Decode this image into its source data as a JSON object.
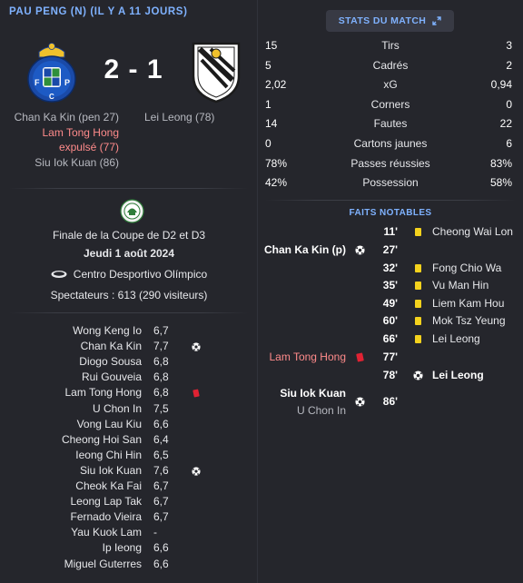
{
  "header": {
    "title": "PAU PENG (N) (IL Y A 11 JOURS)"
  },
  "score": "2 - 1",
  "home_scorers": [
    {
      "text": "Chan Ka Kin (pen 27)",
      "style": "normal"
    },
    {
      "text": "Lam Tong Hong",
      "style": "red"
    },
    {
      "text": "expulsé (77)",
      "style": "red"
    },
    {
      "text": "Siu Iok Kuan (86)",
      "style": "normal"
    }
  ],
  "away_scorers": [
    {
      "text": "Lei Leong (78)"
    }
  ],
  "match_info": {
    "competition": "Finale de la Coupe de D2 et D3",
    "date": "Jeudi 1 août 2024",
    "stadium": "Centro Desportivo Olímpico",
    "spectators": "Spectateurs : 613 (290 visiteurs)"
  },
  "lineup": [
    {
      "name": "Wong Keng Io",
      "rating": "6,7",
      "icon": ""
    },
    {
      "name": "Chan Ka Kin",
      "rating": "7,7",
      "icon": "ball"
    },
    {
      "name": "Diogo Sousa",
      "rating": "6,8",
      "icon": ""
    },
    {
      "name": "Rui Gouveia",
      "rating": "6,8",
      "icon": ""
    },
    {
      "name": "Lam Tong Hong",
      "rating": "6,8",
      "icon": "red"
    },
    {
      "name": "U Chon In",
      "rating": "7,5",
      "icon": ""
    },
    {
      "name": "Vong Lau Kiu",
      "rating": "6,6",
      "icon": ""
    },
    {
      "name": "Cheong Hoi San",
      "rating": "6,4",
      "icon": ""
    },
    {
      "name": "Ieong Chi Hin",
      "rating": "6,5",
      "icon": ""
    },
    {
      "name": "Siu Iok Kuan",
      "rating": "7,6",
      "icon": "ball"
    },
    {
      "name": "Cheok Ka Fai",
      "rating": "6,7",
      "icon": ""
    },
    {
      "name": "Leong Lap Tak",
      "rating": "6,7",
      "icon": ""
    },
    {
      "name": "Fernado Vieira",
      "rating": "6,7",
      "icon": ""
    },
    {
      "name": "Yau Kuok Lam",
      "rating": "-",
      "icon": ""
    },
    {
      "name": "Ip Ieong",
      "rating": "6,6",
      "icon": ""
    },
    {
      "name": "Miguel Guterres",
      "rating": "6,6",
      "icon": ""
    }
  ],
  "stats_button": {
    "label": "STATS DU MATCH"
  },
  "stats": [
    {
      "label": "Tirs",
      "home": "15",
      "away": "3"
    },
    {
      "label": "Cadrés",
      "home": "5",
      "away": "2"
    },
    {
      "label": "xG",
      "home": "2,02",
      "away": "0,94"
    },
    {
      "label": "Corners",
      "home": "1",
      "away": "0"
    },
    {
      "label": "Fautes",
      "home": "14",
      "away": "22"
    },
    {
      "label": "Cartons jaunes",
      "home": "0",
      "away": "6"
    },
    {
      "label": "Passes réussies",
      "home": "78%",
      "away": "83%"
    },
    {
      "label": "Possession",
      "home": "42%",
      "away": "58%"
    }
  ],
  "events_title": "FAITS NOTABLES",
  "events": [
    {
      "minute": "11'",
      "side": "away",
      "type": "yellow",
      "player": "Cheong Wai Lon"
    },
    {
      "minute": "27'",
      "side": "home",
      "type": "goal",
      "player": "Chan Ka Kin (p)"
    },
    {
      "minute": "32'",
      "side": "away",
      "type": "yellow",
      "player": "Fong Chio Wa"
    },
    {
      "minute": "35'",
      "side": "away",
      "type": "yellow",
      "player": "Vu Man Hin"
    },
    {
      "minute": "49'",
      "side": "away",
      "type": "yellow",
      "player": "Liem Kam Hou"
    },
    {
      "minute": "60'",
      "side": "away",
      "type": "yellow",
      "player": "Mok Tsz Yeung"
    },
    {
      "minute": "66'",
      "side": "away",
      "type": "yellow",
      "player": "Lei Leong"
    },
    {
      "minute": "77'",
      "side": "home",
      "type": "red",
      "player": "Lam Tong Hong"
    },
    {
      "minute": "78'",
      "side": "away",
      "type": "goal",
      "player": "Lei Leong"
    },
    {
      "minute": "86'",
      "side": "home",
      "type": "goal",
      "player": "Siu Iok Kuan",
      "assist": "U Chon In"
    }
  ],
  "colors": {
    "accent": "#7fb2ff",
    "background": "#25262c",
    "yellow_card": "#f4d21d",
    "red_card": "#e02233",
    "red_text": "#ff8b8b"
  }
}
